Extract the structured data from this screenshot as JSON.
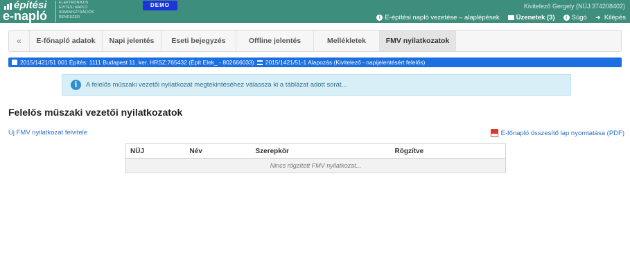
{
  "header": {
    "logo": {
      "word1": "építési",
      "word2": "e-napló",
      "subtitle_lines": [
        "ELEKTRONIKUS",
        "ÉPÍTÉSI NAPLÓ",
        "ADMINISZTRÁCIÓS",
        "RENDSZER"
      ]
    },
    "demo_badge": "DEMO",
    "user": "Kivitelező Gergely (NÜJ:374208402)",
    "links": {
      "howto": "E-építési napló vezetése – alaplépések",
      "messages": "Üzenetek (3)",
      "help": "Súgó",
      "logout": "Kilépés"
    },
    "icons": {
      "howto": "info-circle-icon",
      "messages": "envelope-icon",
      "help": "info-circle-icon",
      "logout": "arrow-right-icon"
    },
    "colors": {
      "bar": "#3e8e7e",
      "demo": "#1b35d8"
    }
  },
  "tabs": {
    "collapse": "«",
    "items": [
      "E-főnapló adatok",
      "Napi jelentés",
      "Eseti bejegyzés",
      "Offline jelentés",
      "Mellékletek",
      "FMV nyilatkozatok"
    ],
    "active": "FMV nyilatkozatok"
  },
  "context_bar": {
    "project": "2015/1421/51 001 Építés: 1111 Budapest 11. ker. HRSZ:765432 (Épít Elek_ - 802666033)",
    "diary": "2015/1421/51-1 Alapozás (Kivitelező - napijelentésért felelős)",
    "color": "#1c6fe0"
  },
  "alert": {
    "icon": "info-icon",
    "text": "A felelős műszaki vezetői nyilatkozat megtekintéséhez válassza ki a táblázat adott sorát..."
  },
  "main": {
    "title": "Felelős műszaki vezetői nyilatkozatok",
    "new_link": "Új FMV nyilatkozat felvitele",
    "pdf_link": "E-főnapló összesítő lap nyomtatása (PDF)",
    "table": {
      "columns": [
        "NÜJ",
        "Név",
        "Szerepkör",
        "Rögzítve"
      ],
      "empty_message": "Nincs rögzített FMV nyilatkozat..."
    }
  }
}
